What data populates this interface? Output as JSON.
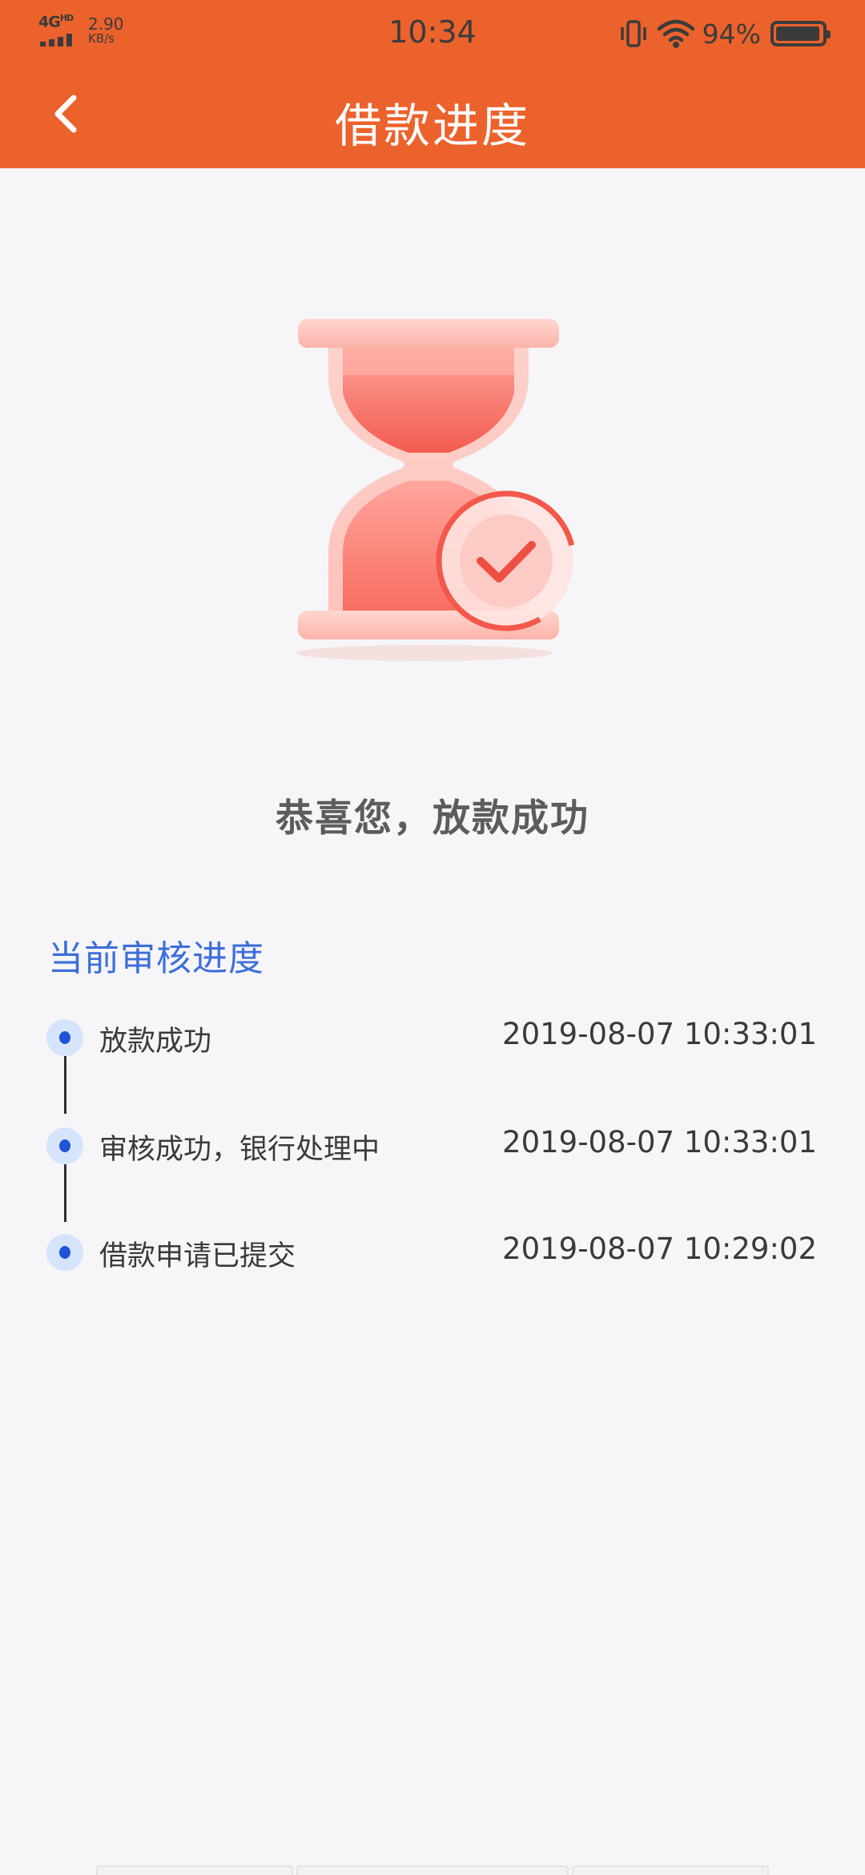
{
  "status_bar": {
    "network": "4G",
    "network_sup": "HD",
    "speed_value": "2.90",
    "speed_unit": "KB/s",
    "time": "10:34",
    "battery_percent": "94%",
    "battery_level": 0.94
  },
  "header": {
    "title": "借款进度",
    "back_icon": "chevron-left-icon"
  },
  "hero": {
    "icon": "hourglass-check-icon",
    "headline": "恭喜您，放款成功"
  },
  "progress": {
    "title": "当前审核进度",
    "steps": [
      {
        "label": "放款成功",
        "time": "2019-08-07 10:33:01"
      },
      {
        "label": "审核成功，银行处理中",
        "time": "2019-08-07 10:33:01"
      },
      {
        "label": "借款申请已提交",
        "time": "2019-08-07 10:29:02"
      }
    ]
  },
  "colors": {
    "brand_orange": "#ec622c",
    "section_blue": "#3d6fd9",
    "dot_blue": "#2053d6",
    "hero_red": "#f05a4a"
  }
}
